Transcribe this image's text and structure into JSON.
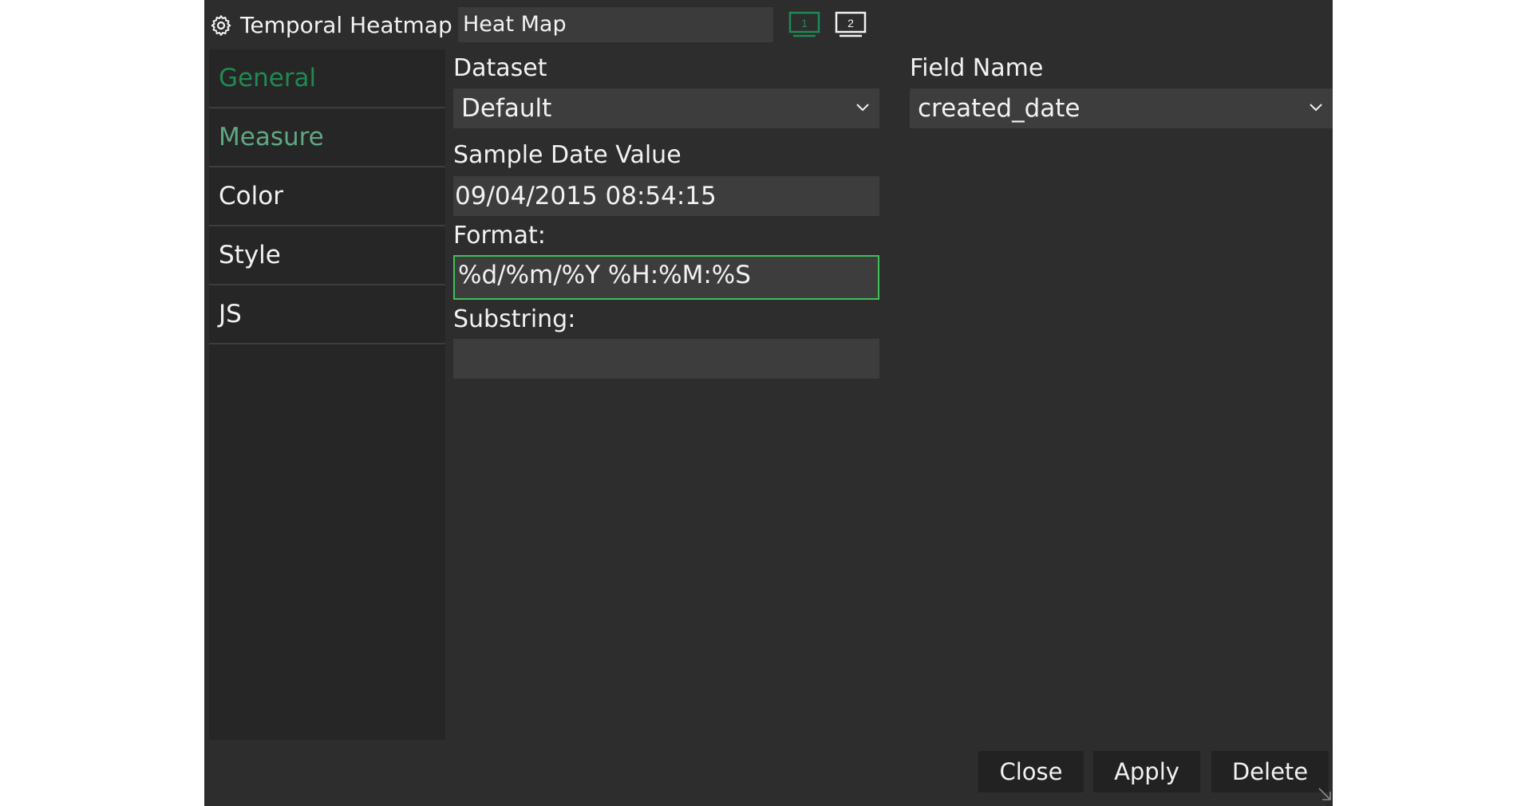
{
  "window": {
    "title": "Temporal Heatmap",
    "name_value": "Heat Map",
    "screen1_label": "1",
    "screen2_label": "2"
  },
  "sidebar": {
    "items": [
      {
        "label": "General"
      },
      {
        "label": "Measure"
      },
      {
        "label": "Color"
      },
      {
        "label": "Style"
      },
      {
        "label": "JS"
      }
    ]
  },
  "form": {
    "dataset_label": "Dataset",
    "dataset_value": "Default",
    "field_name_label": "Field Name",
    "field_name_value": "created_date",
    "sample_date_label": "Sample Date Value",
    "sample_date_value": "09/04/2015 08:54:15",
    "format_label": "Format:",
    "format_value": "%d/%m/%Y %H:%M:%S",
    "substring_label": "Substring:",
    "substring_value": ""
  },
  "footer": {
    "close_label": "Close",
    "apply_label": "Apply",
    "delete_label": "Delete"
  },
  "colors": {
    "accent": "#1f8a52",
    "focus_border": "#3fbf5a",
    "background": "#2d2d2d"
  },
  "icons": [
    "gear-icon",
    "screen-1-icon",
    "screen-2-icon",
    "chevron-down-icon",
    "resize-handle-icon"
  ]
}
